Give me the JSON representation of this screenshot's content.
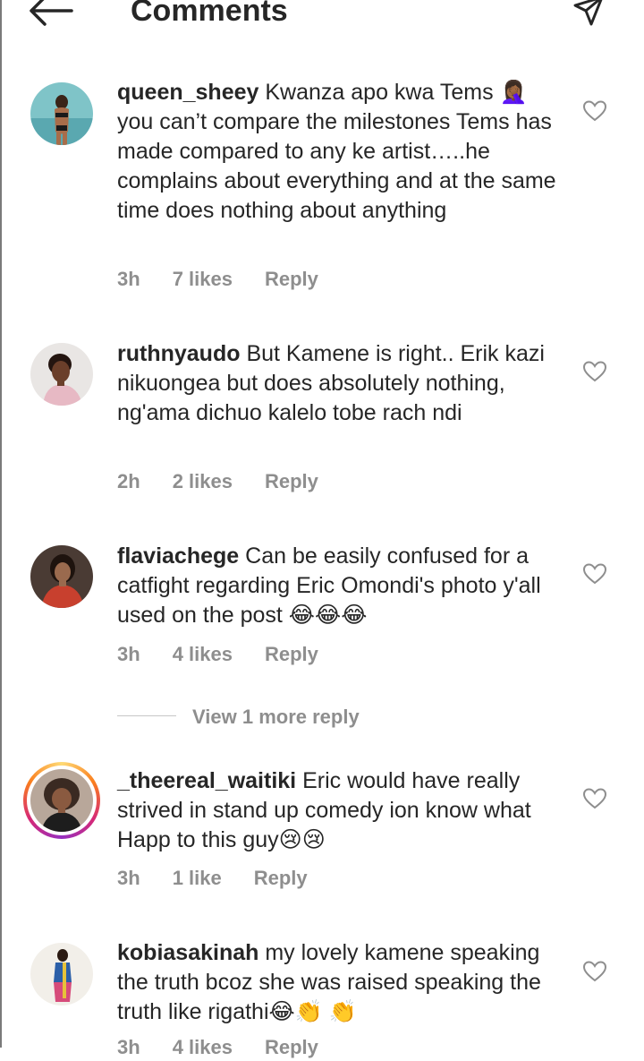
{
  "header": {
    "title": "Comments",
    "back_icon": "arrow-left-icon",
    "send_icon": "paper-plane-icon"
  },
  "comments": [
    {
      "username": "queen_sheey",
      "text": "Kwanza apo kwa Tems 🤦🏾‍♀️ you can’t compare the milestones Tems has made compared to any ke artist…..he complains about everything and at the same time does nothing about anything",
      "time": "3h",
      "likes": "7 likes",
      "reply": "Reply"
    },
    {
      "username": "ruthnyaudo",
      "text": "But Kamene is right.. Erik kazi nikuongea but does absolutely nothing, ng'ama dichuo kalelo tobe rach ndi",
      "time": "2h",
      "likes": "2 likes",
      "reply": "Reply"
    },
    {
      "username": "flaviachege",
      "text": "Can be easily confused for a catfight regarding Eric Omondi's photo y'all used on the post 😂😂😂",
      "time": "3h",
      "likes": "4 likes",
      "reply": "Reply"
    },
    {
      "username": "_theereal_waitiki",
      "text": "Eric would have really strived in stand up comedy ion know what Happ to this guy😢😢",
      "time": "3h",
      "likes": "1 like",
      "reply": "Reply"
    },
    {
      "username": "kobiasakinah",
      "text": "my lovely kamene speaking the truth bcoz she was raised speaking the truth like rigathi😂👏 👏",
      "time": "3h",
      "likes": "4 likes",
      "reply": "Reply"
    }
  ],
  "view_more_replies": "View 1 more reply",
  "colors": {
    "text": "#262626",
    "secondary": "#8e8e8e",
    "divider": "#c7c7c7",
    "story_ring": "#d62976"
  }
}
